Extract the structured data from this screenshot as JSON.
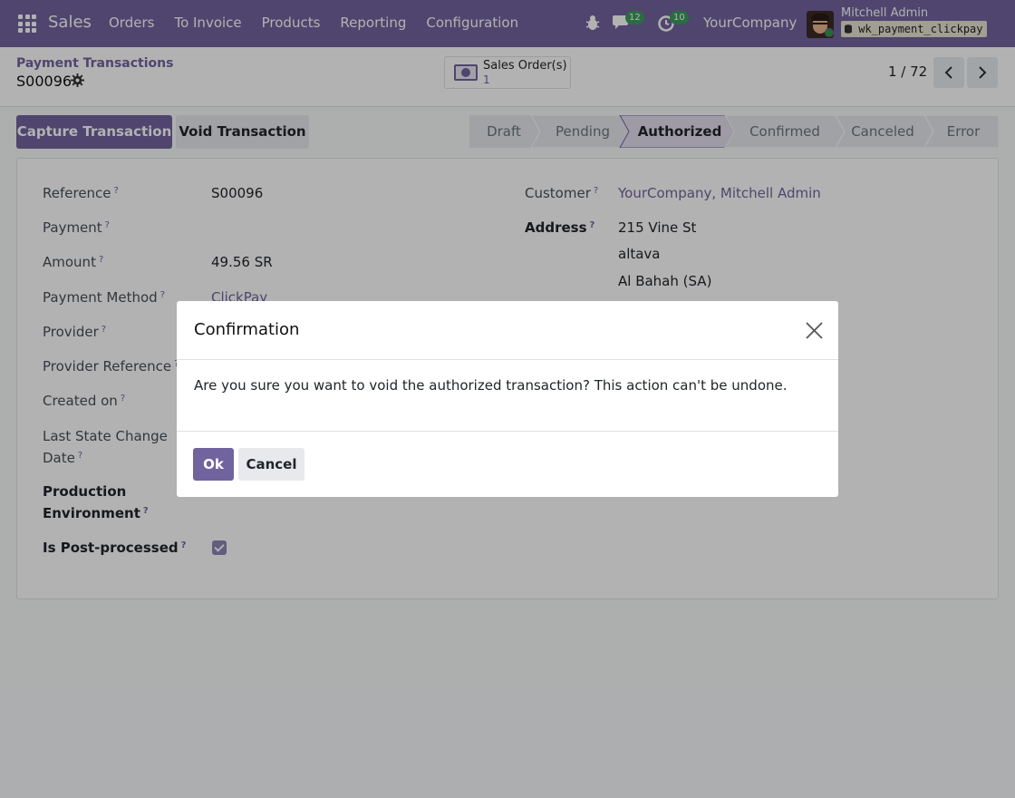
{
  "navbar": {
    "app_name": "Sales",
    "menu": [
      "Orders",
      "To Invoice",
      "Products",
      "Reporting",
      "Configuration"
    ],
    "messages_count": "12",
    "activities_count": "10",
    "company": "YourCompany",
    "user_name": "Mitchell Admin",
    "database": "wk_payment_clickpay",
    "database_icon": "database-icon",
    "accent_color": "#71639e"
  },
  "control": {
    "breadcrumb": "Payment Transactions",
    "record_name": "S00096",
    "smart_button_label": "Sales Order(s)",
    "smart_button_value": "1",
    "pager": "1 / 72"
  },
  "actions": {
    "capture_label": "Capture Transaction",
    "void_label": "Void Transaction"
  },
  "statusbar": {
    "stages": [
      "Draft",
      "Pending",
      "Authorized",
      "Confirmed",
      "Canceled",
      "Error"
    ],
    "active": "Authorized"
  },
  "form": {
    "left": [
      {
        "label": "Reference",
        "value": "S00096"
      },
      {
        "label": "Payment",
        "value": ""
      },
      {
        "label": "Amount",
        "value": "49.56 SR"
      },
      {
        "label": "Payment Method",
        "value": "ClickPay"
      },
      {
        "label": "Provider",
        "value": ""
      },
      {
        "label": "Provider Reference",
        "value": ""
      },
      {
        "label": "Created on",
        "value": ""
      },
      {
        "label_line1": "Last State Change",
        "label_line2": "Date",
        "value": ""
      },
      {
        "label_line1": "Production",
        "label_line2": "Environment",
        "value": ""
      },
      {
        "label": "Is Post-processed",
        "checked": true
      }
    ],
    "customer_label": "Customer",
    "customer_value": "YourCompany, Mitchell Admin",
    "address_label": "Address",
    "address_lines": [
      "215 Vine St",
      "altava",
      "Al Bahah (SA)"
    ]
  },
  "dialog": {
    "title": "Confirmation",
    "message": "Are you sure you want to void the authorized transaction? This action can't be undone.",
    "ok_label": "Ok",
    "cancel_label": "Cancel"
  }
}
